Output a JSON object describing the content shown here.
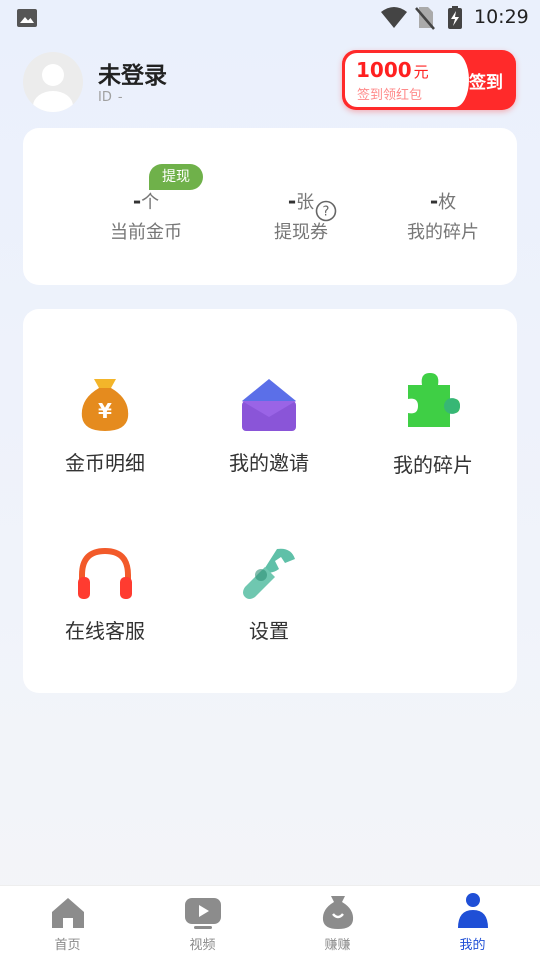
{
  "status_bar": {
    "time": "10:29"
  },
  "header": {
    "username": "未登录",
    "id_label": "ID",
    "id_value": "-",
    "signin": {
      "amount": "1000",
      "amount_unit": "元",
      "subtitle": "签到领红包",
      "action": "去签到"
    }
  },
  "stats": {
    "withdraw_badge": "提现",
    "items": [
      {
        "value": "-",
        "unit": "个",
        "label": "当前金币"
      },
      {
        "value": "-",
        "unit": "张",
        "label": "提现券"
      },
      {
        "value": "-",
        "unit": "枚",
        "label": "我的碎片"
      }
    ]
  },
  "grid": {
    "items": [
      {
        "label": "金币明细",
        "icon": "money-bag-icon"
      },
      {
        "label": "我的邀请",
        "icon": "envelope-icon"
      },
      {
        "label": "我的碎片",
        "icon": "puzzle-icon"
      },
      {
        "label": "在线客服",
        "icon": "headphones-icon"
      },
      {
        "label": "设置",
        "icon": "wrench-icon"
      }
    ]
  },
  "bottom_nav": {
    "items": [
      {
        "label": "首页",
        "icon": "home-icon"
      },
      {
        "label": "视频",
        "icon": "video-icon"
      },
      {
        "label": "赚赚",
        "icon": "money-bag-icon"
      },
      {
        "label": "我的",
        "icon": "person-icon"
      }
    ],
    "active_color": "#1f4fd6"
  },
  "colors": {
    "accent_red": "#ff2a2a",
    "badge_green": "#6fb14a"
  }
}
